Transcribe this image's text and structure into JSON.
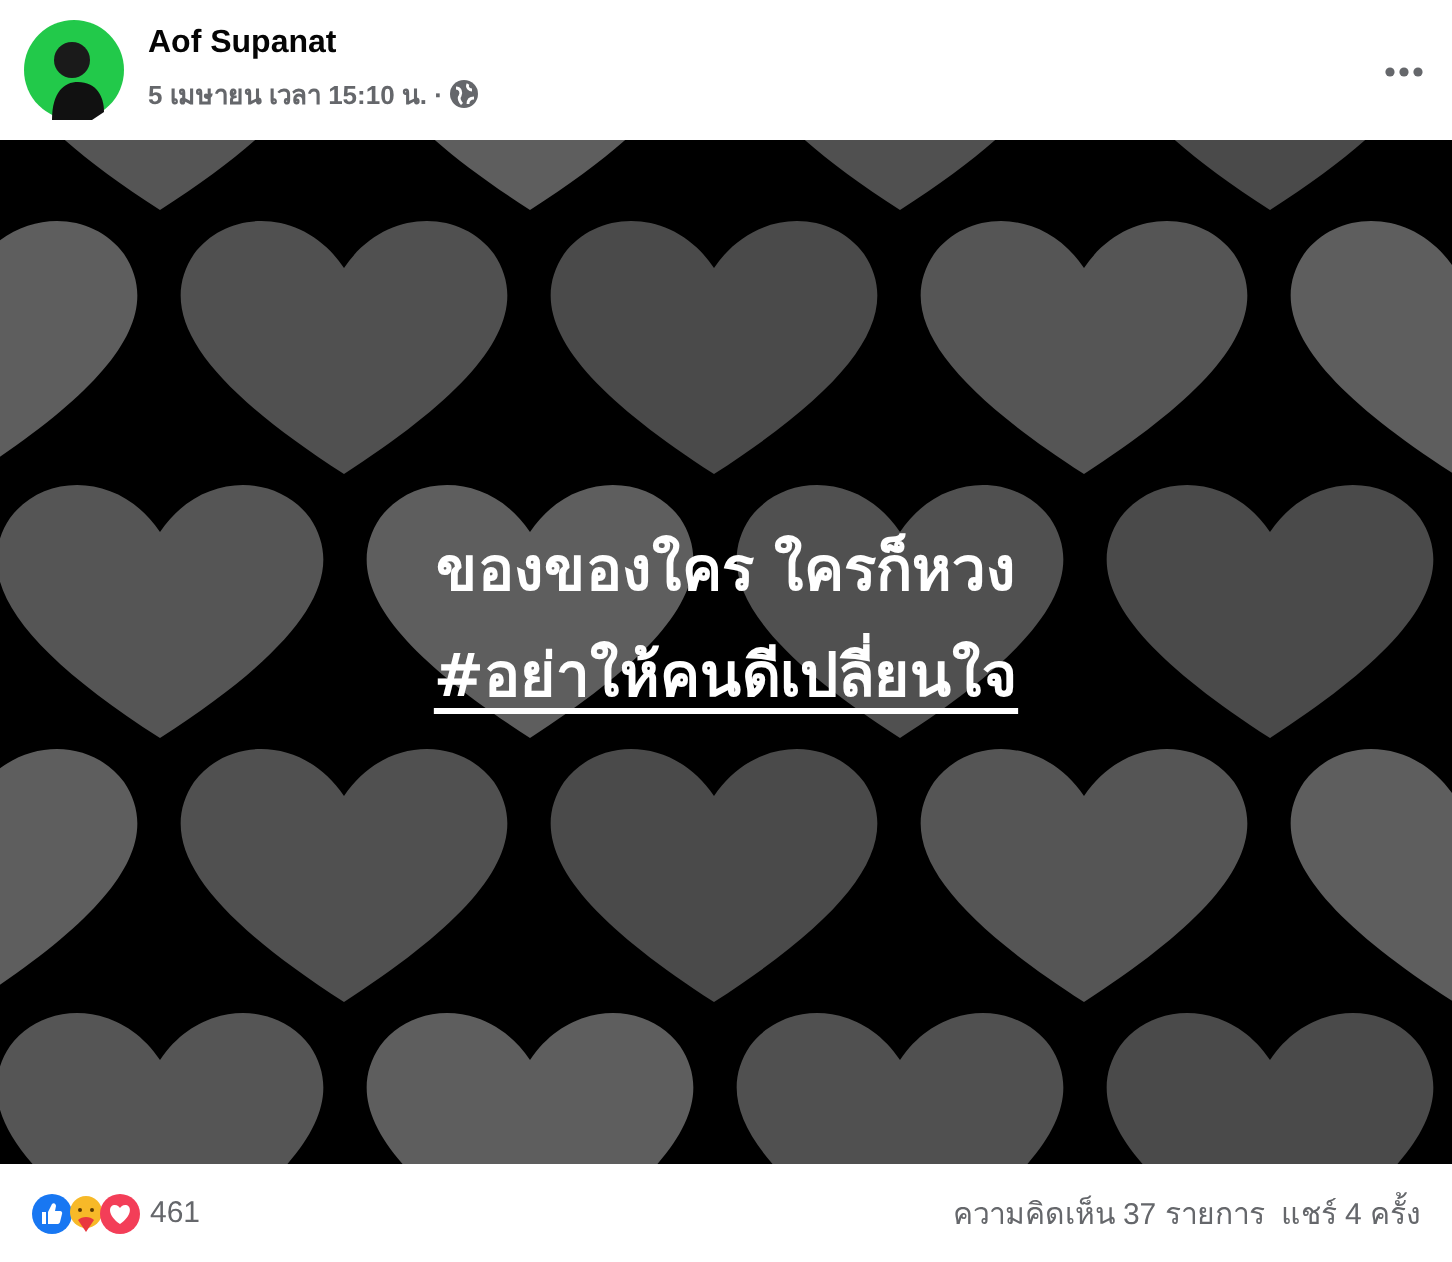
{
  "post": {
    "author": "Aof Supanat",
    "date": "5 เมษายน เวลา 15:10 น. ·",
    "image": {
      "lines": [
        {
          "kind": "plain",
          "text": "ของของใคร ใครก็หวง"
        },
        {
          "kind": "hashtag",
          "text": "#อย่าให้คนดีเปลี่ยนใจ"
        }
      ]
    },
    "footer": {
      "reaction_count": "461",
      "comments": "ความคิดเห็น 37 รายการ",
      "shares": "แชร์ 4 ครั้ง"
    }
  }
}
